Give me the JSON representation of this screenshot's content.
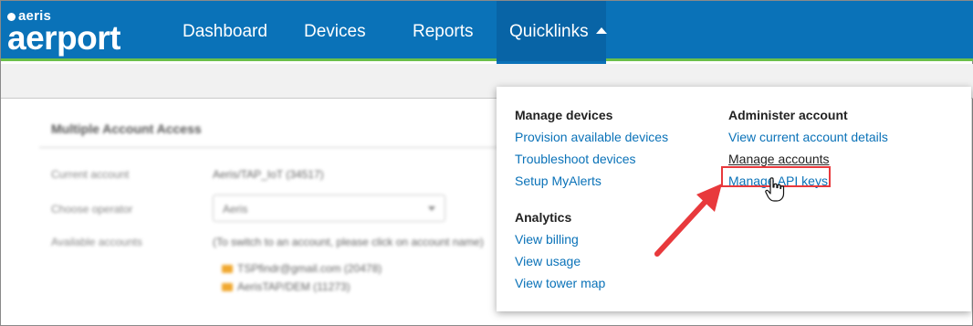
{
  "brand": {
    "small": "aeris",
    "large": "aerport"
  },
  "nav": {
    "items": [
      {
        "label": "Dashboard"
      },
      {
        "label": "Devices"
      },
      {
        "label": "Reports"
      },
      {
        "label": "Quicklinks"
      }
    ]
  },
  "background_panel": {
    "title": "Multiple Account Access",
    "rows": [
      {
        "label": "Current account",
        "value": "Aeris/TAP_IoT (34517)"
      },
      {
        "label": "Choose operator",
        "value": "Aeris"
      },
      {
        "label": "Available accounts",
        "value": "(To switch to an account, please click on account name)"
      }
    ],
    "accounts": [
      "TSPfindr@gmail.com (20478)",
      "AerisTAP/DEM (11273)"
    ]
  },
  "quicklinks_menu": {
    "manage_devices": {
      "heading": "Manage devices",
      "links": [
        "Provision available devices",
        "Troubleshoot devices",
        "Setup MyAlerts"
      ]
    },
    "analytics": {
      "heading": "Analytics",
      "links": [
        "View billing",
        "View usage",
        "View tower map"
      ]
    },
    "administer_account": {
      "heading": "Administer account",
      "links": [
        "View current account details",
        "Manage accounts",
        "Manage API keys"
      ]
    }
  },
  "colors": {
    "header_bg": "#0a72b8",
    "header_accent": "#6cc04a",
    "link": "#0a72b8",
    "highlight": "#e8393c"
  }
}
